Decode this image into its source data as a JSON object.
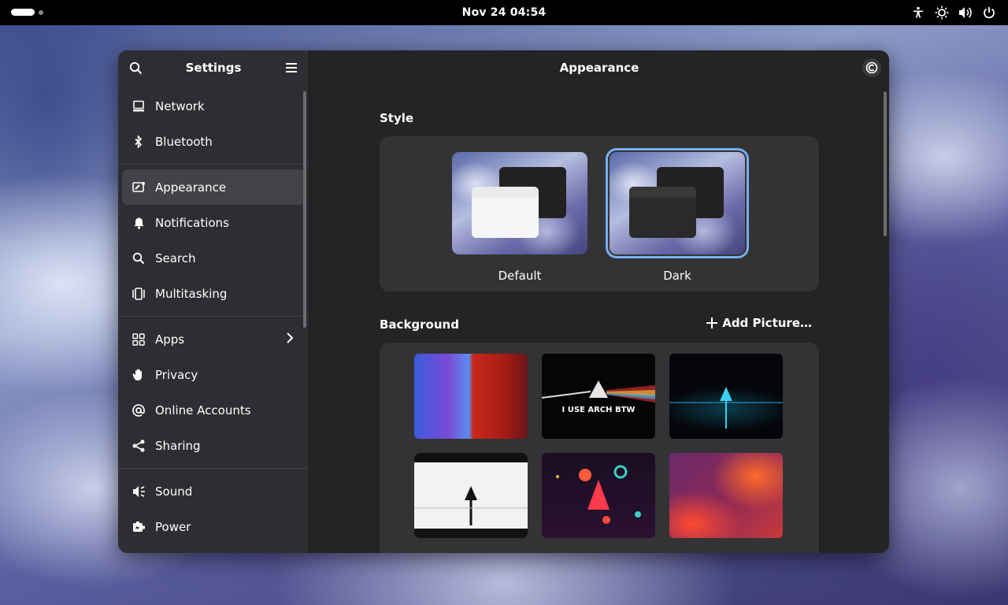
{
  "topbar": {
    "clock": "Nov 24  04:54",
    "icons": [
      "accessibility-icon",
      "brightness-icon",
      "volume-icon",
      "power-icon"
    ]
  },
  "sidebar": {
    "title": "Settings",
    "items": [
      {
        "label": "Network",
        "icon": "network-icon"
      },
      {
        "label": "Bluetooth",
        "icon": "bluetooth-icon"
      },
      {
        "label": "Appearance",
        "icon": "appearance-icon",
        "active": true
      },
      {
        "label": "Notifications",
        "icon": "bell-icon"
      },
      {
        "label": "Search",
        "icon": "search-icon"
      },
      {
        "label": "Multitasking",
        "icon": "multitasking-icon"
      },
      {
        "label": "Apps",
        "icon": "apps-grid-icon",
        "chevron": true
      },
      {
        "label": "Privacy",
        "icon": "hand-icon"
      },
      {
        "label": "Online Accounts",
        "icon": "at-sign-icon"
      },
      {
        "label": "Sharing",
        "icon": "share-icon"
      },
      {
        "label": "Sound",
        "icon": "speaker-icon"
      },
      {
        "label": "Power",
        "icon": "battery-icon"
      }
    ]
  },
  "content": {
    "title": "Appearance",
    "style_section": {
      "title": "Style",
      "options": [
        {
          "label": "Default",
          "selected": false
        },
        {
          "label": "Dark",
          "selected": true
        }
      ]
    },
    "background_section": {
      "title": "Background",
      "add_label": "Add Picture…",
      "wallpapers": [
        {
          "name": "abstract-blue-red"
        },
        {
          "name": "arch-prism",
          "text": "I USE ARCH BTW"
        },
        {
          "name": "arch-neon-grid"
        },
        {
          "name": "arch-white-road"
        },
        {
          "name": "arch-planets"
        },
        {
          "name": "purple-orange-gradient"
        }
      ]
    }
  },
  "colors": {
    "accent": "#78aeed",
    "window_bg": "#242424",
    "sidebar_bg": "#2e2e32",
    "card_bg": "#333336"
  }
}
